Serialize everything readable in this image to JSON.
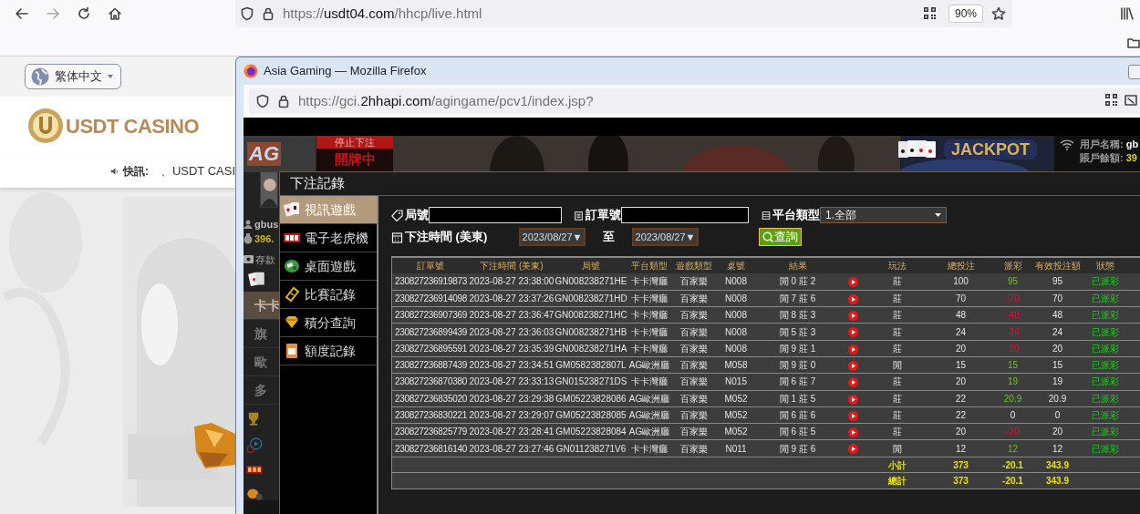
{
  "browser": {
    "url": {
      "prefix": "https://",
      "domain": "usdt04.com",
      "path": "/hhcp/live.html"
    },
    "zoom": "90%"
  },
  "site": {
    "language": "繁体中文",
    "logo": "USDT CASINO",
    "news_label": "快訊:",
    "news_text": "、USDT CASI"
  },
  "popup": {
    "title": "Asia Gaming — Mozilla Firefox",
    "url": {
      "prefix": "https://gci.",
      "domain": "2hhapi.com",
      "path": "/agingame/pcv1/index.jsp?"
    }
  },
  "game": {
    "logo": "AG",
    "status_label": "停止下注",
    "status": "開牌中",
    "jackpot": "JACKPOT",
    "info": [
      {
        "label": "用戶名稱:",
        "value": "gb",
        "color": "#ffffff"
      },
      {
        "label": "賬戶餘額:",
        "value": "39",
        "color": "#e6d200"
      }
    ],
    "player": {
      "name": "gbus",
      "balance": "396."
    },
    "deposit": "存款",
    "side_items": [
      {
        "label": "卡卡",
        "selected": true
      },
      {
        "label": "旗",
        "selected": false
      },
      {
        "label": "歐",
        "selected": false
      },
      {
        "label": "多",
        "selected": false
      }
    ]
  },
  "dialog": {
    "title": "下注記錄",
    "menu": [
      {
        "label": "視訊遊戲",
        "selected": true
      },
      {
        "label": "電子老虎機",
        "selected": false
      },
      {
        "label": "桌面遊戲",
        "selected": false
      },
      {
        "label": "比賽記錄",
        "selected": false
      },
      {
        "label": "積分查詢",
        "selected": false
      },
      {
        "label": "額度記錄",
        "selected": false
      }
    ],
    "filters": {
      "round_label": "局號",
      "order_label": "訂單號",
      "platform_label": "平台類型",
      "platform_value": "1.全部",
      "time_label": "下注時間 (美東)",
      "date_from": "2023/08/27▼",
      "to_label": "至",
      "date_to": "2023/08/27▼",
      "query": "查詢"
    },
    "table": {
      "columns": [
        "訂單號",
        "下注時間 (美東)",
        "局號",
        "平台類型",
        "遊戲類型",
        "桌號",
        "結果",
        "玩法",
        "總投注",
        "派彩",
        "有效投注額",
        "狀態"
      ],
      "rows": [
        {
          "cells": [
            "230827236919873",
            "2023-08-27 23:38:00",
            "GN008238271HE",
            "卡卡灣廳",
            "百家樂",
            "N008",
            "閒 0 莊 2",
            "莊",
            "100",
            "95",
            "95",
            "已派彩"
          ],
          "kind": "win"
        },
        {
          "cells": [
            "230827236914098",
            "2023-08-27 23:37:26",
            "GN008238271HD",
            "卡卡灣廳",
            "百家樂",
            "N008",
            "閒 7 莊 6",
            "莊",
            "70",
            "-70",
            "70",
            "已派彩"
          ],
          "kind": "loss"
        },
        {
          "cells": [
            "230827236907369",
            "2023-08-27 23:36:47",
            "GN008238271HC",
            "卡卡灣廳",
            "百家樂",
            "N008",
            "閒 8 莊 3",
            "莊",
            "48",
            "-48",
            "48",
            "已派彩"
          ],
          "kind": "loss"
        },
        {
          "cells": [
            "230827236899439",
            "2023-08-27 23:36:03",
            "GN008238271HB",
            "卡卡灣廳",
            "百家樂",
            "N008",
            "閒 5 莊 3",
            "莊",
            "24",
            "-24",
            "24",
            "已派彩"
          ],
          "kind": "loss"
        },
        {
          "cells": [
            "230827236895591",
            "2023-08-27 23:35:39",
            "GN008238271HA",
            "卡卡灣廳",
            "百家樂",
            "N008",
            "閒 9 莊 1",
            "莊",
            "20",
            "-20",
            "20",
            "已派彩"
          ],
          "kind": "loss"
        },
        {
          "cells": [
            "230827236887439",
            "2023-08-27 23:34:51",
            "GM0582382807L",
            "AG歐洲廳",
            "百家樂",
            "M058",
            "閒 9 莊 0",
            "閒",
            "15",
            "15",
            "15",
            "已派彩"
          ],
          "kind": "win"
        },
        {
          "cells": [
            "230827236870380",
            "2023-08-27 23:33:13",
            "GN015238271DS",
            "卡卡灣廳",
            "百家樂",
            "N015",
            "閒 6 莊 7",
            "莊",
            "20",
            "19",
            "19",
            "已派彩"
          ],
          "kind": "win"
        },
        {
          "cells": [
            "230827236835020",
            "2023-08-27 23:29:38",
            "GM05223828086",
            "AG歐洲廳",
            "百家樂",
            "M052",
            "閒 1 莊 5",
            "莊",
            "22",
            "20.9",
            "20.9",
            "已派彩"
          ],
          "kind": "win"
        },
        {
          "cells": [
            "230827236830221",
            "2023-08-27 23:29:07",
            "GM05223828085",
            "AG歐洲廳",
            "百家樂",
            "M052",
            "閒 6 莊 6",
            "莊",
            "22",
            "0",
            "0",
            "已派彩"
          ],
          "kind": "push"
        },
        {
          "cells": [
            "230827236825779",
            "2023-08-27 23:28:41",
            "GM05223828084",
            "AG歐洲廳",
            "百家樂",
            "M052",
            "閒 6 莊 5",
            "莊",
            "20",
            "-20",
            "20",
            "已派彩"
          ],
          "kind": "loss"
        },
        {
          "cells": [
            "230827236816140",
            "2023-08-27 23:27:46",
            "GN011238271V6",
            "卡卡灣廳",
            "百家樂",
            "N011",
            "閒 9 莊 6",
            "閒",
            "12",
            "12",
            "12",
            "已派彩"
          ],
          "kind": "win"
        }
      ],
      "footer": [
        {
          "label": "小計",
          "total": "373",
          "payout": "-20.1",
          "valid": "343.9"
        },
        {
          "label": "總計",
          "total": "373",
          "payout": "-20.1",
          "valid": "343.9"
        }
      ]
    }
  }
}
